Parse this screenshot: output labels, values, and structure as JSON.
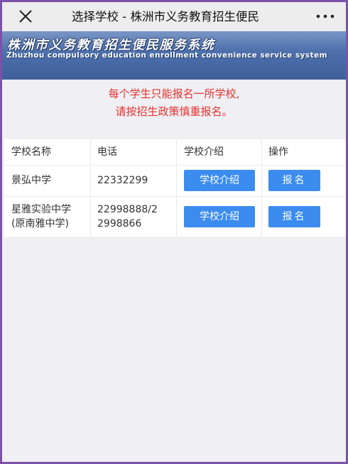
{
  "navbar": {
    "title": "选择学校 - 株洲市义务教育招生便民",
    "close_icon": "close-icon",
    "more_icon": "more-icon"
  },
  "banner": {
    "title": "株洲市义务教育招生便民服务系统",
    "subtitle": "Zhuzhou compulsory education enrollment convenience service system"
  },
  "notice": {
    "line1": "每个学生只能报名一所学校,",
    "line2": "请按招生政策慎重报名。",
    "color": "#e5322d"
  },
  "table": {
    "headers": [
      "学校名称",
      "电话",
      "学校介绍",
      "操作"
    ],
    "rows": [
      {
        "name_line1": "景弘中学",
        "name_line2": "",
        "phone_line1": "22332299",
        "phone_line2": "",
        "intro_button": "学校介绍",
        "action_button": "报名"
      },
      {
        "name_line1": "星雅实验中学",
        "name_line2": "(原南雅中学)",
        "phone_line1": "22998888/2",
        "phone_line2": "2998866",
        "intro_button": "学校介绍",
        "action_button": "报名"
      }
    ]
  },
  "colors": {
    "accent_button": "#3c8cf0",
    "banner": "#4a6ca8",
    "frame_border": "#7b52a8"
  }
}
